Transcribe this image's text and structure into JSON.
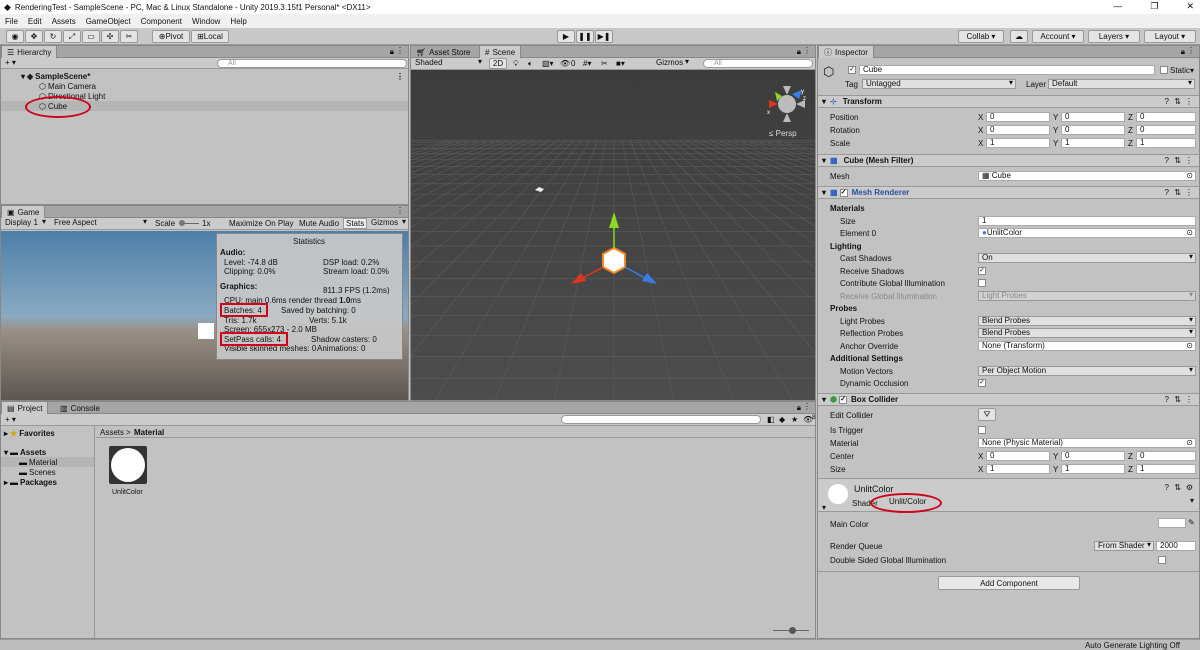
{
  "window": {
    "title": "RenderingTest - SampleScene - PC, Mac & Linux Standalone - Unity 2019.3.15f1 Personal* <DX11>",
    "min": "—",
    "max": "❐",
    "close": "✕"
  },
  "menu": [
    "File",
    "Edit",
    "Assets",
    "GameObject",
    "Component",
    "Window",
    "Help"
  ],
  "toolbar": {
    "pivot": "Pivot",
    "local": "Local",
    "collab": "Collab ▾",
    "account": "Account",
    "layers": "Layers",
    "layout": "Layout"
  },
  "hierarchy": {
    "tab": "Hierarchy",
    "search_placeholder": "All",
    "scene": "SampleScene*",
    "items": [
      "Main Camera",
      "Directional Light",
      "Cube"
    ]
  },
  "scene_view": {
    "tab_store": "Asset Store",
    "tab_scene": "Scene",
    "shading": "Shaded",
    "mode2d": "2D",
    "gizmos": "Gizmos",
    "search_placeholder": "All",
    "persp": "≤ Persp",
    "fx_count": "0"
  },
  "game": {
    "tab": "Game",
    "display": "Display 1",
    "aspect": "Free Aspect",
    "scale_label": "Scale",
    "scale_value": "1x",
    "maximize": "Maximize On Play",
    "mute": "Mute Audio",
    "stats": "Stats",
    "gizmos": "Gizmos"
  },
  "stats": {
    "title": "Statistics",
    "audio": "Audio:",
    "level": "Level: -74.8 dB",
    "clipping": "Clipping: 0.0%",
    "dsp": "DSP load: 0.2%",
    "stream": "Stream load: 0.0%",
    "graphics": "Graphics:",
    "fps": "811.3 FPS (1.2ms)",
    "cpu_prefix": "CPU: main 0.6ms  render thread ",
    "cpu_render": "1.0",
    "cpu_suffix": "ms",
    "batches": "Batches: 4",
    "saved": "Saved by batching: 0",
    "tris": "Tris: 1.7k",
    "verts": "Verts: 5.1k",
    "screen": "Screen: 655x273 - 2.0 MB",
    "setpass": "SetPass calls: 4",
    "shadow": "Shadow casters: 0",
    "skinned": "Visible skinned meshes: 0",
    "animations": "Animations: 0"
  },
  "project": {
    "tab": "Project",
    "tab_console": "Console",
    "add": "+ ▾",
    "favorites": "Favorites",
    "assets": "Assets",
    "material": "Material",
    "scenes": "Scenes",
    "packages": "Packages",
    "breadcrumb_root": "Assets",
    "breadcrumb_sep": ">",
    "breadcrumb_leaf": "Material",
    "asset_name": "UnlitColor",
    "count": "8"
  },
  "inspector": {
    "tab": "Inspector",
    "object_name": "Cube",
    "static": "Static",
    "tag_label": "Tag",
    "tag_value": "Untagged",
    "layer_label": "Layer",
    "layer_value": "Default",
    "transform": {
      "title": "Transform",
      "rows": [
        {
          "label": "Position",
          "x": "0",
          "y": "0",
          "z": "0"
        },
        {
          "label": "Rotation",
          "x": "0",
          "y": "0",
          "z": "0"
        },
        {
          "label": "Scale",
          "x": "1",
          "y": "1",
          "z": "1"
        }
      ]
    },
    "mesh_filter": {
      "title": "Cube (Mesh Filter)",
      "mesh_label": "Mesh",
      "mesh_value": "Cube"
    },
    "mesh_renderer": {
      "title": "Mesh Renderer",
      "materials": "Materials",
      "size_label": "Size",
      "size_value": "1",
      "element_label": "Element 0",
      "element_value": "UnlitColor",
      "lighting": "Lighting",
      "cast_label": "Cast Shadows",
      "cast_value": "On",
      "receive_label": "Receive Shadows",
      "contrib_label": "Contribute Global Illumination",
      "rgi_label": "Receive Global Illumination",
      "rgi_value": "Light Probes",
      "probes": "Probes",
      "lp_label": "Light Probes",
      "lp_value": "Blend Probes",
      "rp_label": "Reflection Probes",
      "rp_value": "Blend Probes",
      "anchor_label": "Anchor Override",
      "anchor_value": "None (Transform)",
      "additional": "Additional Settings",
      "mv_label": "Motion Vectors",
      "mv_value": "Per Object Motion",
      "occ_label": "Dynamic Occlusion"
    },
    "box_collider": {
      "title": "Box Collider",
      "edit_label": "Edit Collider",
      "trigger_label": "Is Trigger",
      "material_label": "Material",
      "material_value": "None (Physic Material)",
      "center": {
        "label": "Center",
        "x": "0",
        "y": "0",
        "z": "0"
      },
      "size": {
        "label": "Size",
        "x": "1",
        "y": "1",
        "z": "1"
      }
    },
    "material": {
      "name": "UnlitColor",
      "shader_label": "Shader",
      "shader_value": "Unlit/Color",
      "main_color_label": "Main Color",
      "rq_label": "Render Queue",
      "rq_mode": "From Shader",
      "rq_value": "2000",
      "dsgi_label": "Double Sided Global Illumination"
    },
    "add_component": "Add Component"
  },
  "status": {
    "text": "Auto Generate Lighting Off"
  },
  "colors": {
    "accent": "#d0021b",
    "x_axis": "#e0341e",
    "y_axis": "#8cd820",
    "z_axis": "#3b7de8",
    "cube": "#f58a1f"
  }
}
